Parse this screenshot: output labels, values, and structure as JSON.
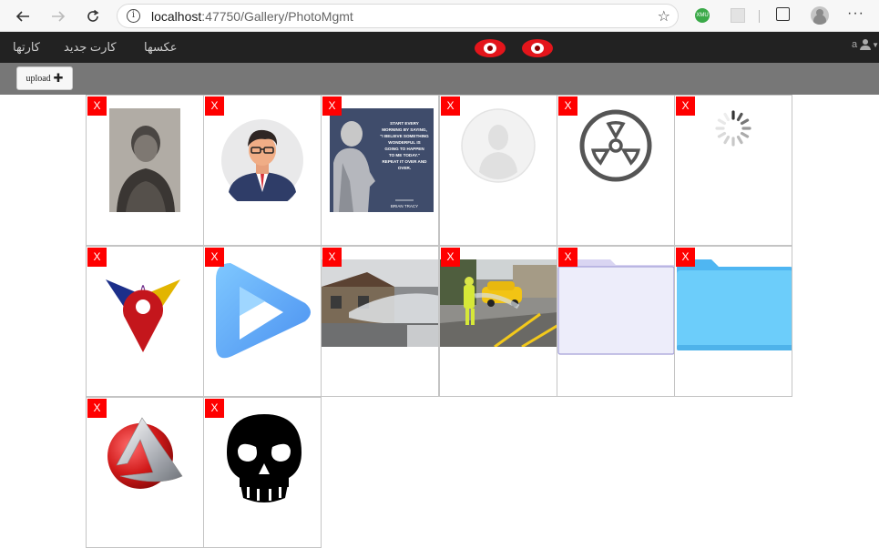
{
  "browser": {
    "url_host": "localhost",
    "url_rest": ":47750/Gallery/PhotoMgmt",
    "ext_label": "XMU",
    "icons": [
      "back-arrow-icon",
      "forward-arrow-icon",
      "refresh-icon",
      "info-icon",
      "favorites-star-icon",
      "collections-icon",
      "profile-icon",
      "more-icon"
    ]
  },
  "navbar": {
    "links": [
      "کارتها",
      "کارت جدید",
      "عکسها"
    ],
    "user": "a",
    "logo_color": "#e4151b"
  },
  "toolbar": {
    "upload_label": "upload"
  },
  "gallery": {
    "delete_label": "X",
    "delete_color": "#ff0000",
    "items": [
      {
        "icon": "child-photo"
      },
      {
        "icon": "man-avatar"
      },
      {
        "icon": "quote-poster"
      },
      {
        "icon": "default-user-avatar"
      },
      {
        "icon": "radiation-icon"
      },
      {
        "icon": "loading-spinner"
      },
      {
        "icon": "location-pin-logo"
      },
      {
        "icon": "play-logo"
      },
      {
        "icon": "street-photo"
      },
      {
        "icon": "worker-photo"
      },
      {
        "icon": "folder-purple"
      },
      {
        "icon": "folder-blue"
      },
      {
        "icon": "red-sphere-logo"
      },
      {
        "icon": "skull-icon"
      }
    ],
    "poster_text": [
      "START EVERY",
      "MORNING BY SAYING,",
      "\"I BELIEVE SOMETHING",
      "WONDERFUL IS",
      "GOING TO HAPPEN",
      "TO ME TODAY.\"",
      "REPEAT IT OVER AND",
      "OVER.",
      "BRIAN TRACY"
    ]
  }
}
